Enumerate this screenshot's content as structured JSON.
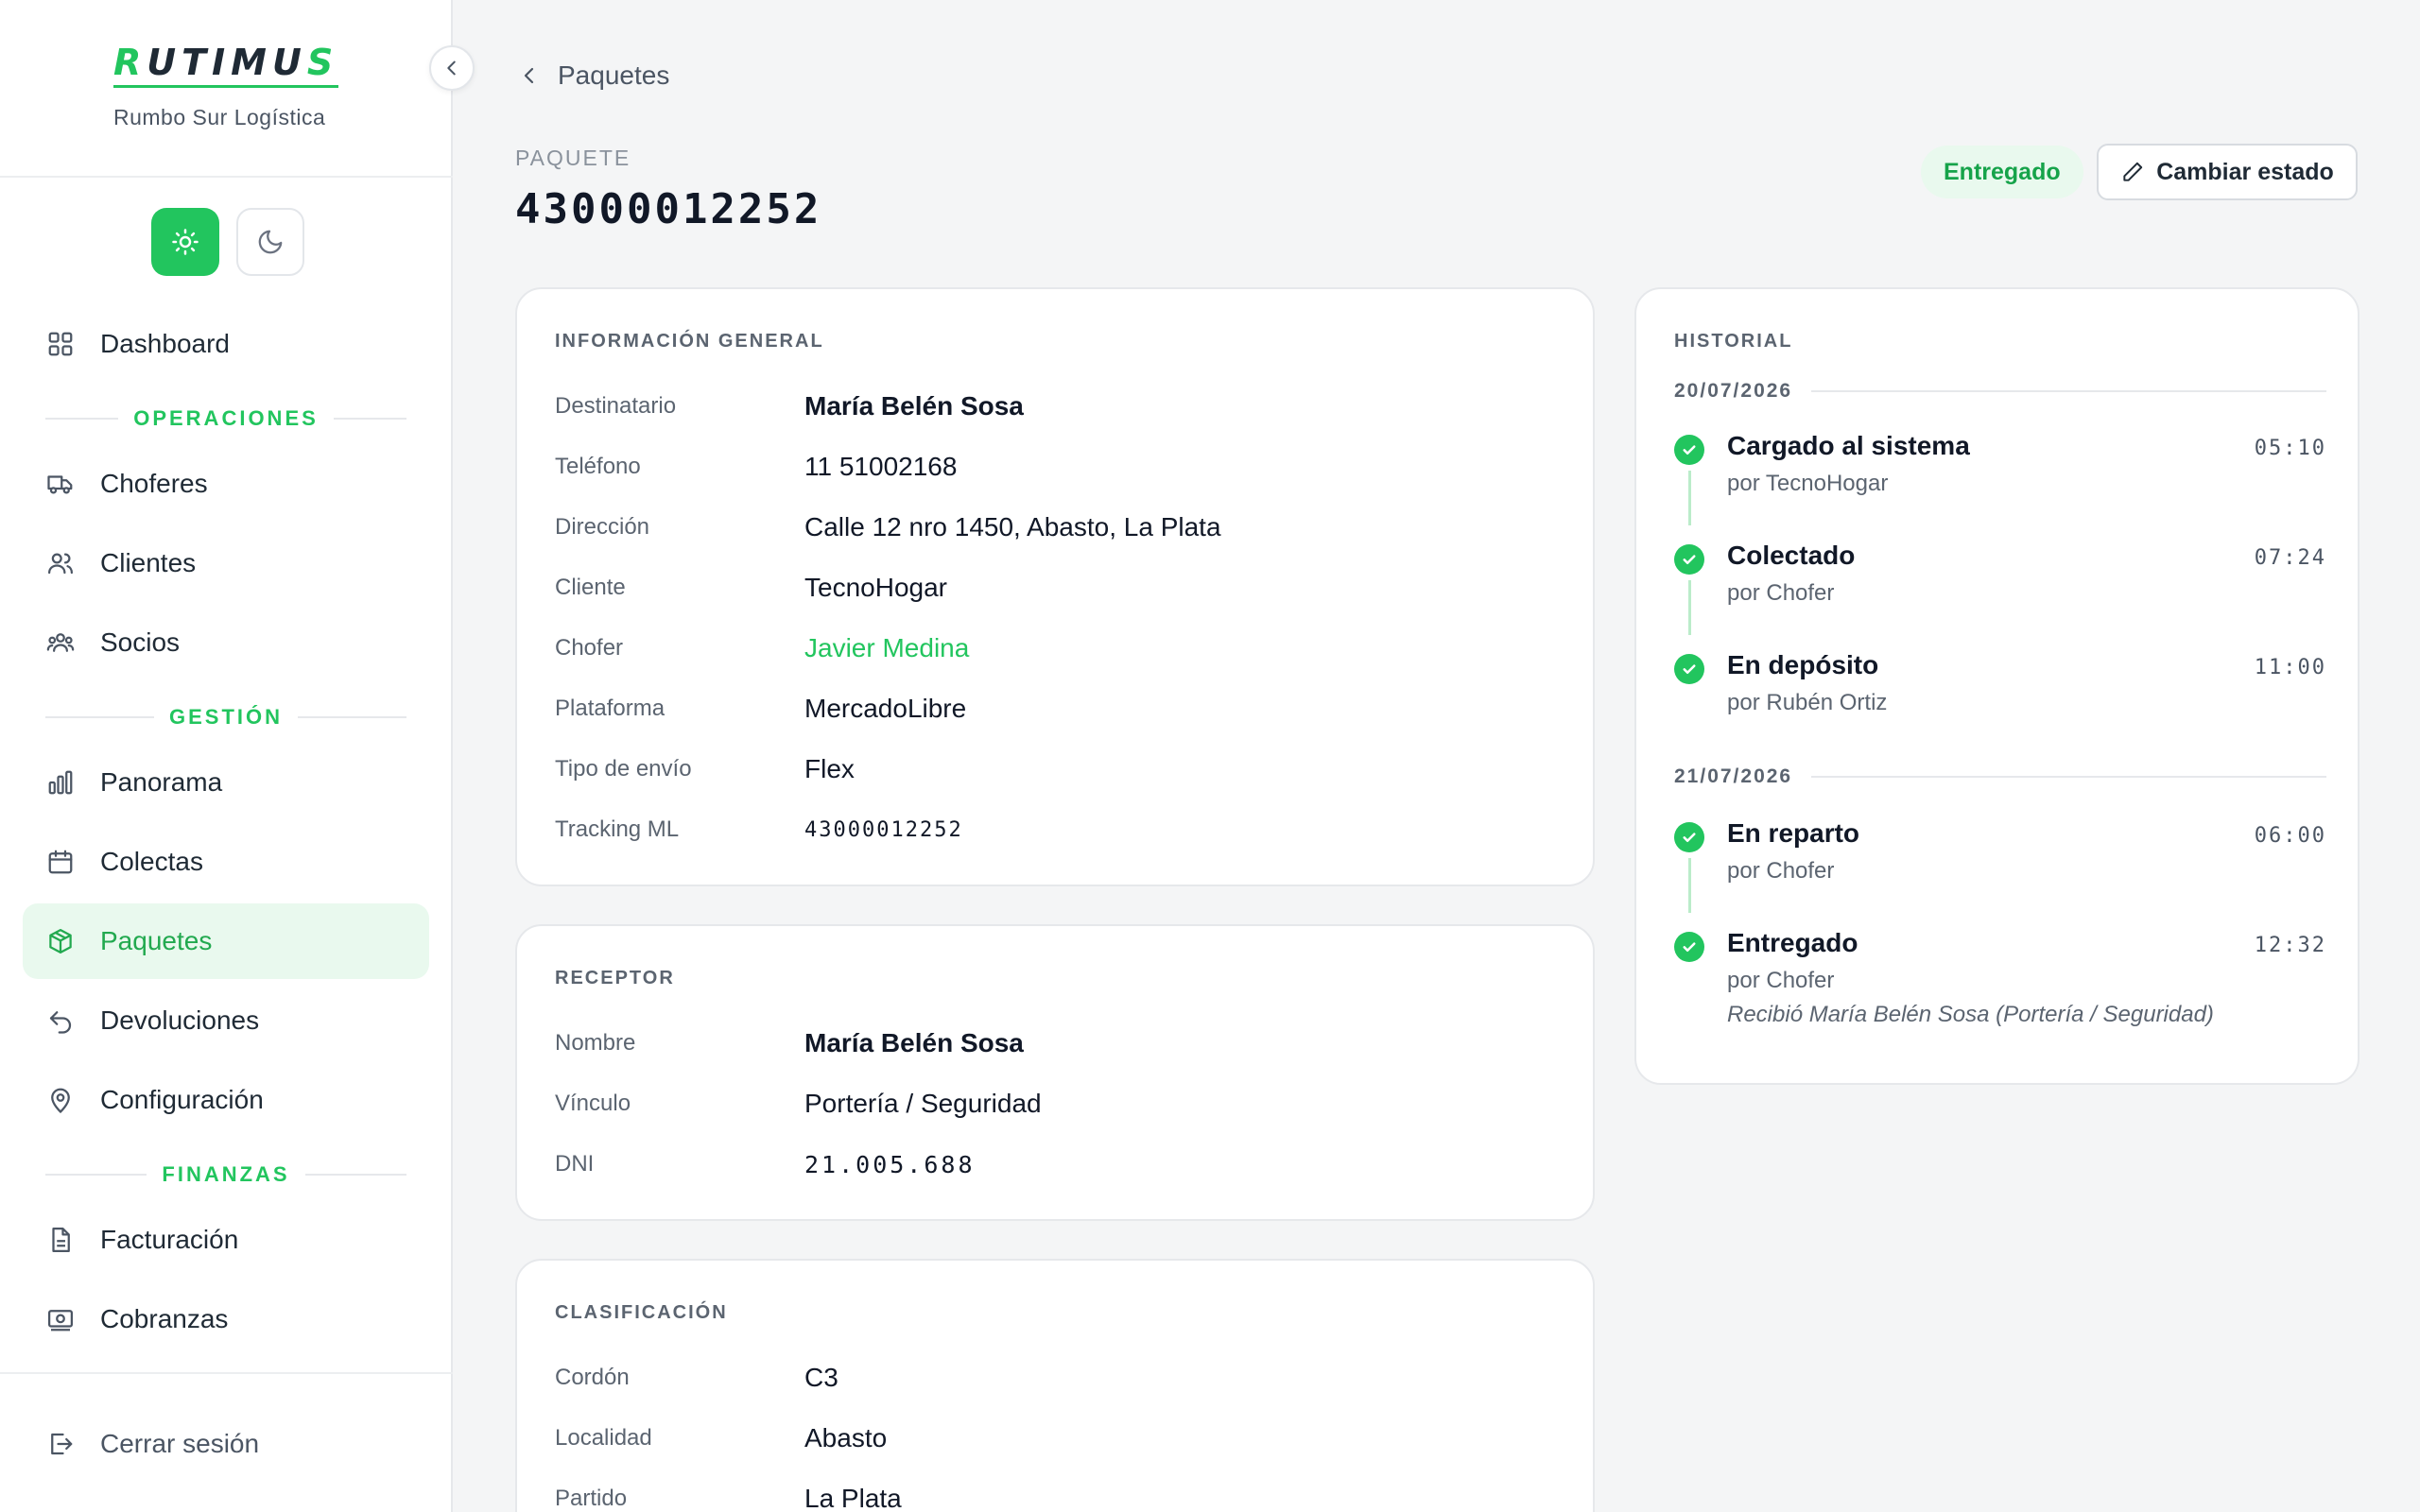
{
  "brand": {
    "logo_text": "RUTIMUS",
    "subtitle": "Rumbo Sur Logística"
  },
  "sidebar": {
    "nav": {
      "dashboard": "Dashboard",
      "sections": {
        "operaciones": "OPERACIONES",
        "gestion": "GESTIÓN",
        "finanzas": "FINANZAS"
      },
      "choferes": "Choferes",
      "clientes": "Clientes",
      "socios": "Socios",
      "panorama": "Panorama",
      "colectas": "Colectas",
      "paquetes": "Paquetes",
      "devoluciones": "Devoluciones",
      "configuracion": "Configuración",
      "facturacion": "Facturación",
      "cobranzas": "Cobranzas"
    },
    "logout": "Cerrar sesión",
    "active_item": "Paquetes"
  },
  "header": {
    "back_label": "Paquetes",
    "eyebrow": "PAQUETE",
    "title": "43000012252",
    "status": "Entregado",
    "change_state_label": "Cambiar estado"
  },
  "general": {
    "title": "INFORMACIÓN GENERAL",
    "rows": [
      {
        "label": "Destinatario",
        "value": "María Belén Sosa"
      },
      {
        "label": "Teléfono",
        "value": "11 51002168"
      },
      {
        "label": "Dirección",
        "value": "Calle 12 nro 1450, Abasto, La Plata"
      },
      {
        "label": "Cliente",
        "value": "TecnoHogar"
      },
      {
        "label": "Chofer",
        "value": "Javier Medina"
      },
      {
        "label": "Plataforma",
        "value": "MercadoLibre"
      },
      {
        "label": "Tipo de envío",
        "value": "Flex"
      },
      {
        "label": "Tracking ML",
        "value": "43000012252"
      }
    ]
  },
  "receptor": {
    "title": "RECEPTOR",
    "rows": [
      {
        "label": "Nombre",
        "value": "María Belén Sosa"
      },
      {
        "label": "Vínculo",
        "value": "Portería / Seguridad"
      },
      {
        "label": "DNI",
        "value": "21.005.688"
      }
    ]
  },
  "clasificacion": {
    "title": "CLASIFICACIÓN",
    "rows": [
      {
        "label": "Cordón",
        "value": "C3"
      },
      {
        "label": "Localidad",
        "value": "Abasto"
      },
      {
        "label": "Partido",
        "value": "La Plata"
      }
    ]
  },
  "historial": {
    "title": "HISTORIAL",
    "groups": [
      {
        "date": "20/07/2026",
        "events": [
          {
            "title": "Cargado al sistema",
            "by": "por TecnoHogar",
            "time": "05:10"
          },
          {
            "title": "Colectado",
            "by": "por Chofer",
            "time": "07:24"
          },
          {
            "title": "En depósito",
            "by": "por Rubén Ortiz",
            "time": "11:00"
          }
        ]
      },
      {
        "date": "21/07/2026",
        "events": [
          {
            "title": "En reparto",
            "by": "por Chofer",
            "time": "06:00"
          },
          {
            "title": "Entregado",
            "by": "por Chofer",
            "time": "12:32",
            "note": "Recibió María Belén Sosa (Portería / Seguridad)"
          }
        ]
      }
    ]
  },
  "colors": {
    "accent": "#22c55e",
    "accent_soft": "#e9f9ee",
    "text": "#111827",
    "muted": "#5b6470"
  }
}
